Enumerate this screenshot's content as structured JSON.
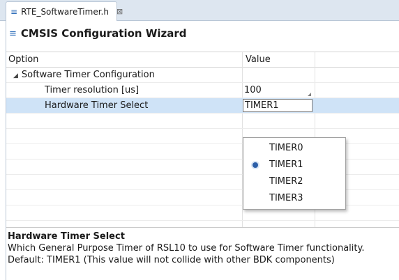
{
  "tab": {
    "filename": "RTE_SoftwareTimer.h",
    "close_glyph": "⊠"
  },
  "wizard": {
    "title": "CMSIS Configuration Wizard"
  },
  "table": {
    "headers": {
      "option": "Option",
      "value": "Value"
    },
    "group": {
      "label": "Software Timer Configuration",
      "expanded": true
    },
    "rows": [
      {
        "option": "Timer resolution [us]",
        "value": "100"
      },
      {
        "option": "Hardware Timer Select",
        "value": "TIMER1",
        "selected": true
      }
    ]
  },
  "dropdown": {
    "options": [
      "TIMER0",
      "TIMER1",
      "TIMER2",
      "TIMER3"
    ],
    "selected": "TIMER1"
  },
  "help": {
    "title": "Hardware Timer Select",
    "lines": [
      "Which General Purpose Timer of RSL10 to use for Software Timer functionality.",
      "Default: TIMER1 (This value will not collide with other BDK components)"
    ]
  },
  "colors": {
    "accent": "#2a6bb8",
    "selection": "#cfe3f7",
    "tabbar": "#dde6f0"
  }
}
